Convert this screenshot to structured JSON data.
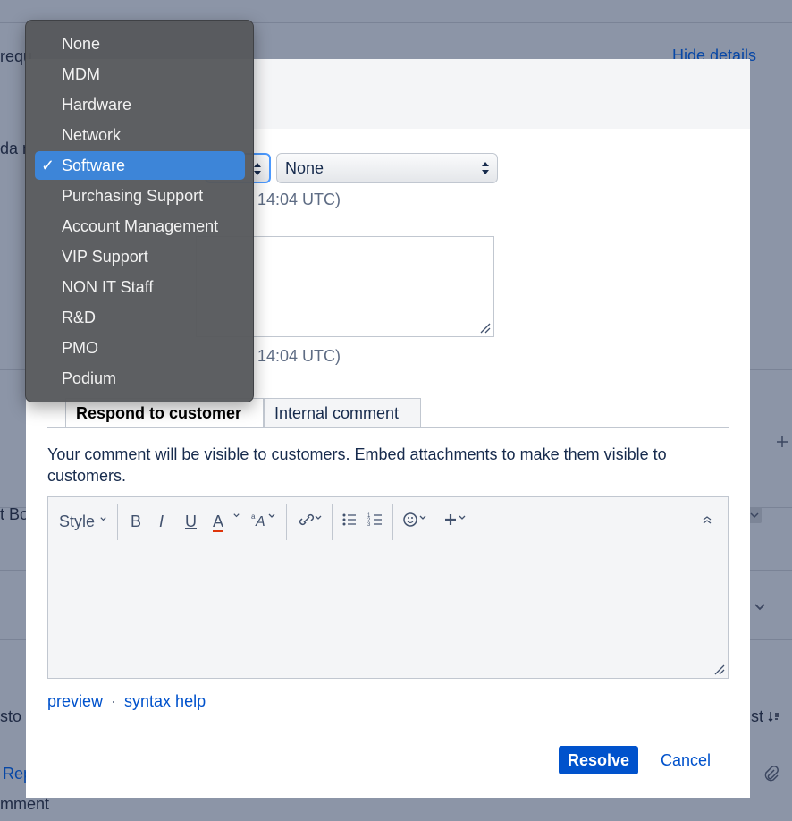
{
  "background": {
    "hide_details": "Hide details",
    "fragment_req": "requ",
    "fragment_da": "da n",
    "fragment_bo": "t Bo",
    "fragment_sto": "sto",
    "fragment_rep": "Rep",
    "fragment_st": "st",
    "fragment_mment": "mment"
  },
  "dropdown": {
    "items": [
      "None",
      "MDM",
      "Hardware",
      "Network",
      "Software",
      "Purchasing Support",
      "Account Management",
      "VIP Support",
      "NON IT Staff",
      "R&D",
      "PMO",
      "Podium"
    ],
    "selected": "Software",
    "check": "✓"
  },
  "form": {
    "secondary_select_value": "None",
    "timestamp_1": "14:04 UTC)",
    "timestamp_2": "14:04 UTC)"
  },
  "tabs": {
    "respond": "Respond to customer",
    "internal": "Internal comment"
  },
  "hint": "Your comment will be visible to customers. Embed attachments to make them visible to customers.",
  "editor": {
    "style_label": "Style",
    "bold": "B",
    "italic": "I",
    "underline": "U",
    "text_color": "A"
  },
  "links": {
    "preview": "preview",
    "dot": "·",
    "syntax_help": "syntax help"
  },
  "actions": {
    "resolve": "Resolve",
    "cancel": "Cancel"
  },
  "colors": {
    "accent": "#0052cc",
    "menu_selected": "#3d85d8",
    "text_color_underline": "#de350b"
  }
}
